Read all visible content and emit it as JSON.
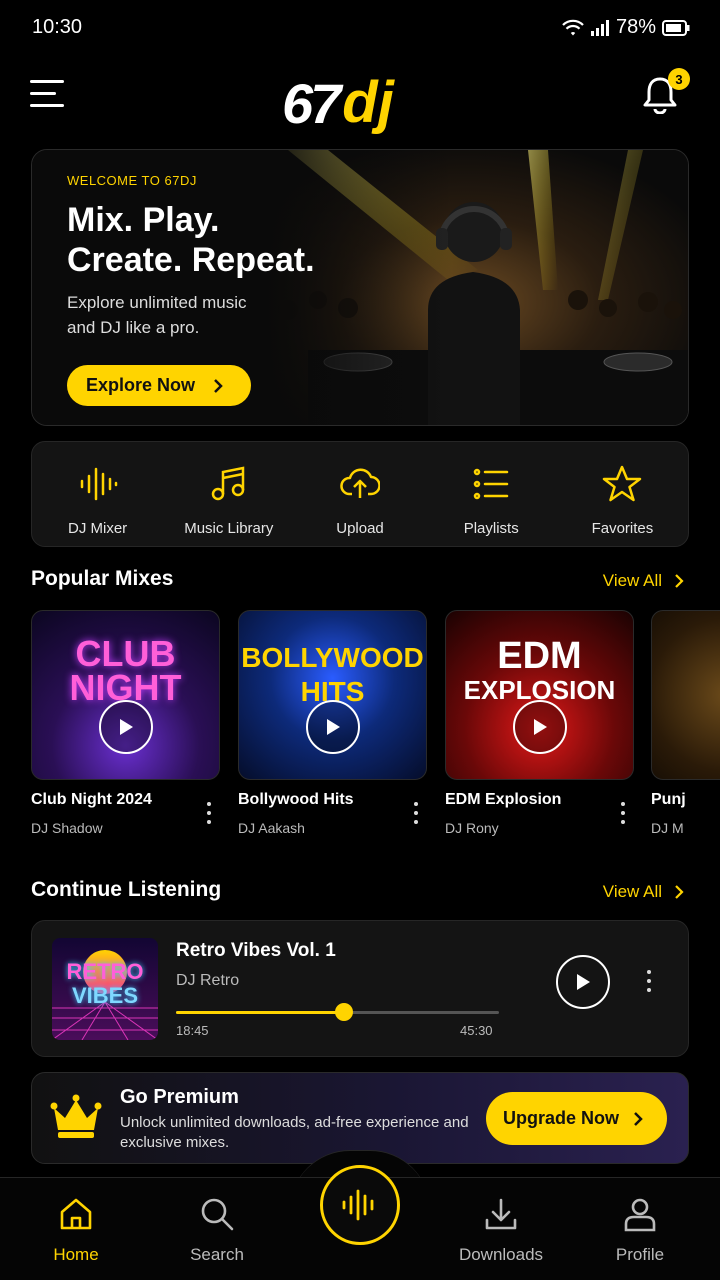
{
  "status_bar": {
    "time": "10:30",
    "battery": "78%"
  },
  "header": {
    "logo_num": "67",
    "logo_dj": "dj",
    "notification_count": "3"
  },
  "hero": {
    "eyebrow": "WELCOME TO 67DJ",
    "headline_line1": "Mix. Play.",
    "headline_line2": "Create. Repeat.",
    "sub_line1": "Explore unlimited music",
    "sub_line2": "and DJ like a pro.",
    "cta_label": "Explore Now"
  },
  "quick_actions": [
    {
      "label": "DJ Mixer",
      "icon": "waveform-icon"
    },
    {
      "label": "Music Library",
      "icon": "music-note-icon"
    },
    {
      "label": "Upload",
      "icon": "cloud-upload-icon"
    },
    {
      "label": "Playlists",
      "icon": "playlist-icon"
    },
    {
      "label": "Favorites",
      "icon": "star-icon"
    }
  ],
  "popular": {
    "title": "Popular Mixes",
    "view_all": "View All",
    "items": [
      {
        "name": "Club Night 2024",
        "artist": "DJ Shadow",
        "cover_line1": "CLUB",
        "cover_line2": "NIGHT"
      },
      {
        "name": "Bollywood Hits",
        "artist": "DJ Aakash",
        "cover_line1": "BOLLYWOOD",
        "cover_line2": "HITS"
      },
      {
        "name": "EDM Explosion",
        "artist": "DJ Rony",
        "cover_line1": "EDM",
        "cover_line2": "EXPLOSION"
      },
      {
        "name": "Punj",
        "artist": "DJ M",
        "cover_line1": "",
        "cover_line2": ""
      }
    ]
  },
  "continue": {
    "title": "Continue Listening",
    "view_all": "View All",
    "track_title": "Retro Vibes Vol. 1",
    "artist": "DJ Retro",
    "thumb_line1": "RETRO",
    "thumb_line2": "VIBES",
    "elapsed": "18:45",
    "duration": "45:30",
    "progress": 0.52
  },
  "premium": {
    "title": "Go Premium",
    "desc": "Unlock unlimited downloads, ad-free experience and exclusive mixes.",
    "cta": "Upgrade Now"
  },
  "nav": {
    "home": "Home",
    "search": "Search",
    "downloads": "Downloads",
    "profile": "Profile"
  },
  "colors": {
    "accent": "#ffd400",
    "background": "#000000",
    "card": "#141414"
  }
}
